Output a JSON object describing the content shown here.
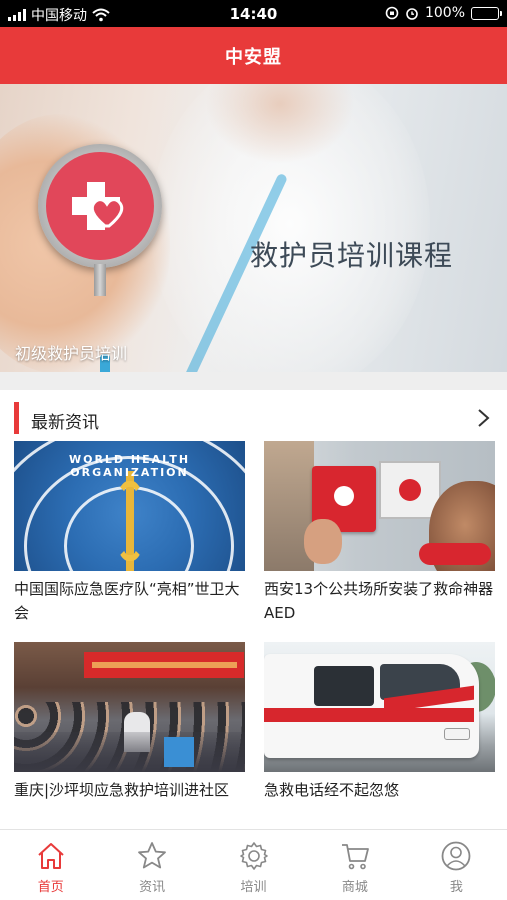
{
  "status_bar": {
    "carrier": "中国移动",
    "time": "14:40",
    "battery": "100%",
    "battery_level": 1.0
  },
  "nav": {
    "title": "中安盟"
  },
  "banner": {
    "title": "救护员培训课程",
    "caption": "初级救护员培训"
  },
  "section": {
    "title": "最新资讯"
  },
  "news": [
    {
      "title": "中国国际应急医疗队“亮相”世卫大会",
      "image_text": "WORLD HEALTH ORGANIZATION"
    },
    {
      "title": "西安13个公共场所安装了救命神器AED",
      "image_text": ""
    },
    {
      "title": "重庆|沙坪坝应急救护培训进社区",
      "image_text": ""
    },
    {
      "title": "急救电话经不起忽悠",
      "image_text": ""
    }
  ],
  "tabs": [
    {
      "label": "首页",
      "icon": "home-icon",
      "active": true
    },
    {
      "label": "资讯",
      "icon": "star-icon",
      "active": false
    },
    {
      "label": "培训",
      "icon": "gear-icon",
      "active": false
    },
    {
      "label": "商城",
      "icon": "cart-icon",
      "active": false
    },
    {
      "label": "我",
      "icon": "user-icon",
      "active": false
    }
  ],
  "colors": {
    "brand_red": "#e83a3a",
    "tab_inactive": "#888888"
  }
}
